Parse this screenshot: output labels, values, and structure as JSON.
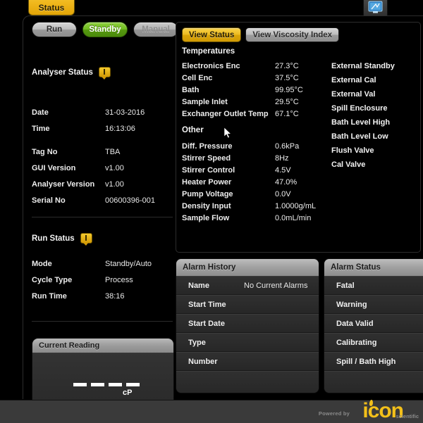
{
  "window": {
    "status_tab_label": "Status",
    "top_icon_name": "network-monitor-icon"
  },
  "mode_buttons": [
    {
      "label": "Run",
      "state": "inactive"
    },
    {
      "label": "Standby",
      "state": "active"
    },
    {
      "label": "Manual",
      "state": "disabled"
    }
  ],
  "analyser_status": {
    "title": "Analyser Status",
    "rows": [
      {
        "key": "Date",
        "value": "31-03-2016"
      },
      {
        "key": "Time",
        "value": "16:13:06"
      },
      {
        "key": "Tag No",
        "value": "TBA"
      },
      {
        "key": "GUI Version",
        "value": "v1.00"
      },
      {
        "key": "Analyser Version",
        "value": "v1.00"
      },
      {
        "key": "Serial No",
        "value": "00600396-001"
      }
    ]
  },
  "run_status": {
    "title": "Run Status",
    "rows": [
      {
        "key": "Mode",
        "value": "Standby/Auto"
      },
      {
        "key": "Cycle Type",
        "value": "Process"
      },
      {
        "key": "Run Time",
        "value": "38:16"
      }
    ]
  },
  "current_reading": {
    "title": "Current Reading",
    "value": "- - - -",
    "unit": "cP"
  },
  "view_tabs": [
    {
      "label": "View Status",
      "state": "active"
    },
    {
      "label": "View Viscosity Index",
      "state": "inactive"
    }
  ],
  "temperatures": {
    "title": "Temperatures",
    "rows": [
      {
        "key": "Electronics Enc",
        "value": "27.3°C"
      },
      {
        "key": "Cell Enc",
        "value": "37.5°C"
      },
      {
        "key": "Bath",
        "value": "99.95°C"
      },
      {
        "key": "Sample Inlet",
        "value": "29.5°C"
      },
      {
        "key": "Exchanger Outlet Temp",
        "value": "67.1°C"
      }
    ]
  },
  "other": {
    "title": "Other",
    "rows": [
      {
        "key": "Diff. Pressure",
        "value": "0.6kPa"
      },
      {
        "key": "Stirrer Speed",
        "value": "8Hz"
      },
      {
        "key": "Stirrer Control",
        "value": "4.5V"
      },
      {
        "key": "Heater Power",
        "value": "47.0%"
      },
      {
        "key": "Pump Voltage",
        "value": "0.0V"
      },
      {
        "key": "Density Input",
        "value": "1.0000g/mL"
      },
      {
        "key": "Sample Flow",
        "value": "0.0mL/min"
      }
    ]
  },
  "indicators": [
    {
      "label": "External Standby"
    },
    {
      "label": "External Cal"
    },
    {
      "label": "External Val"
    },
    {
      "label": "Spill Enclosure"
    },
    {
      "label": "Bath Level High"
    },
    {
      "label": "Bath Level Low"
    },
    {
      "label": "Flush Valve"
    },
    {
      "label": "Cal Valve"
    }
  ],
  "alarm_history": {
    "title": "Alarm History",
    "rows": [
      {
        "key": "Name",
        "value": "No Current Alarms"
      },
      {
        "key": "Start Time",
        "value": ""
      },
      {
        "key": "Start Date",
        "value": ""
      },
      {
        "key": "Type",
        "value": ""
      },
      {
        "key": "Number",
        "value": ""
      }
    ]
  },
  "alarm_status": {
    "title": "Alarm Status",
    "rows": [
      {
        "key": "Fatal",
        "value": ""
      },
      {
        "key": "Warning",
        "value": ""
      },
      {
        "key": "Data Valid",
        "value": ""
      },
      {
        "key": "Calibrating",
        "value": ""
      },
      {
        "key": "Spill / Bath High",
        "value": ""
      }
    ]
  },
  "footer": {
    "powered_by": "Powered by",
    "logo_text": "icon",
    "logo_tail": "scientific"
  },
  "colors": {
    "accent_gold": "#edbb21",
    "active_green": "#6fbb1f",
    "panel_bg": "#2b2b2b",
    "page_bg": "#000000",
    "footer_bg": "#3a3a3a"
  }
}
